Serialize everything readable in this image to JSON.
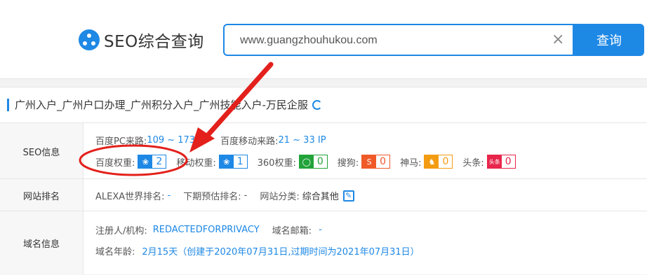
{
  "header": {
    "logo_text": "SEO综合查询",
    "search_value": "www.guangzhouhukou.com",
    "search_button": "查询",
    "clear": "×"
  },
  "site": {
    "title": "广州入户_广州户口办理_广州积分入户_广州技能入户-万民企服"
  },
  "seo": {
    "label": "SEO信息",
    "pc_label": "百度PC来路:",
    "pc_value": "109 ~ 173",
    "mobile_label": "百度移动来路:",
    "mobile_value": "21 ~ 33 IP",
    "baidu_label": "百度权重:",
    "baidu_value": "2",
    "mobile_weight_label": "移动权重:",
    "mobile_weight_value": "1",
    "w360_label": "360权重:",
    "w360_value": "0",
    "sogou_label": "搜狗:",
    "sogou_value": "0",
    "shenma_label": "神马:",
    "shenma_value": "0",
    "toutiao_label": "头条:",
    "toutiao_value": "0"
  },
  "rank": {
    "label": "网站排名",
    "alexa_label": "ALEXA世界排名:",
    "alexa_value": "-",
    "next_label": "下期预估排名:",
    "next_value": "-",
    "category_label": "网站分类:",
    "category_value": "综合其他"
  },
  "domain": {
    "label": "域名信息",
    "owner_label": "注册人/机构:",
    "owner_value": "REDACTEDFORPRIVACY",
    "email_label": "域名邮箱:",
    "email_value": "-",
    "age_label": "域名年龄:",
    "age_value": "2月15天（创建于2020年07月31日,过期时间为2021年07月31日）"
  },
  "colors": {
    "accent": "#1e88e5",
    "annotation": "#e3201b",
    "w360": "#22a33a",
    "sogou": "#f05a28",
    "shenma": "#f39c12",
    "toutiao": "#e8254b"
  }
}
